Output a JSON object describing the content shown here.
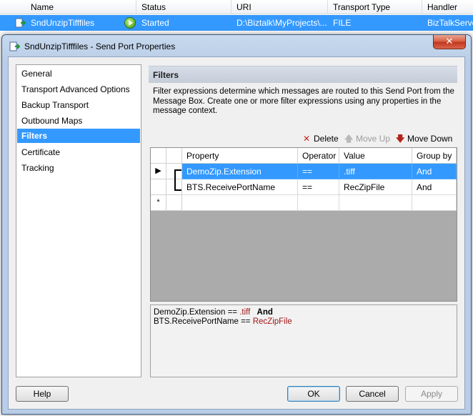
{
  "background_list": {
    "columns": [
      "Name",
      "Status",
      "URI",
      "Transport Type",
      "Handler"
    ],
    "selected_row": {
      "name": "SndUnzipTifffiles",
      "status": "Started",
      "uri": "D:\\Biztalk\\MyProjects\\...",
      "transport": "FILE",
      "handler": "BizTalkServer"
    }
  },
  "dialog": {
    "title": "SndUnzipTifffiles - Send Port Properties",
    "close_label": "✕",
    "nav_items": [
      {
        "label": "General",
        "selected": false
      },
      {
        "label": "Transport Advanced Options",
        "selected": false
      },
      {
        "label": "Backup Transport",
        "selected": false
      },
      {
        "label": "Outbound Maps",
        "selected": false
      },
      {
        "label": "Filters",
        "selected": true
      },
      {
        "label": "Certificate",
        "selected": false
      },
      {
        "label": "Tracking",
        "selected": false
      }
    ],
    "panel": {
      "header": "Filters",
      "description": "Filter expressions determine which messages are routed to this Send Port from the Message Box. Create one or more filter expressions using any properties in the message context."
    },
    "toolbar": {
      "delete": "Delete",
      "move_up": "Move Up",
      "move_down": "Move Down"
    },
    "grid": {
      "columns": [
        "Property",
        "Operator",
        "Value",
        "Group by"
      ],
      "rows": [
        {
          "property": "DemoZip.Extension",
          "operator": "==",
          "value": ".tiff",
          "group": "And",
          "selected": true
        },
        {
          "property": "BTS.ReceivePortName",
          "operator": "==",
          "value": "RecZipFile",
          "group": "And",
          "selected": false
        }
      ],
      "new_row_marker": "*"
    },
    "preview": {
      "line1_prop": "DemoZip.Extension",
      "line1_op": "==",
      "line1_val": ".tiff",
      "line1_group": "And",
      "line2_prop": "BTS.ReceivePortName",
      "line2_op": "==",
      "line2_val": "RecZipFile"
    },
    "buttons": {
      "help": "Help",
      "ok": "OK",
      "cancel": "Cancel",
      "apply": "Apply"
    }
  },
  "colors": {
    "selection": "#3399ff",
    "title_bar": "#b9cde6",
    "close": "#c0361c",
    "value_red": "#a31515"
  }
}
